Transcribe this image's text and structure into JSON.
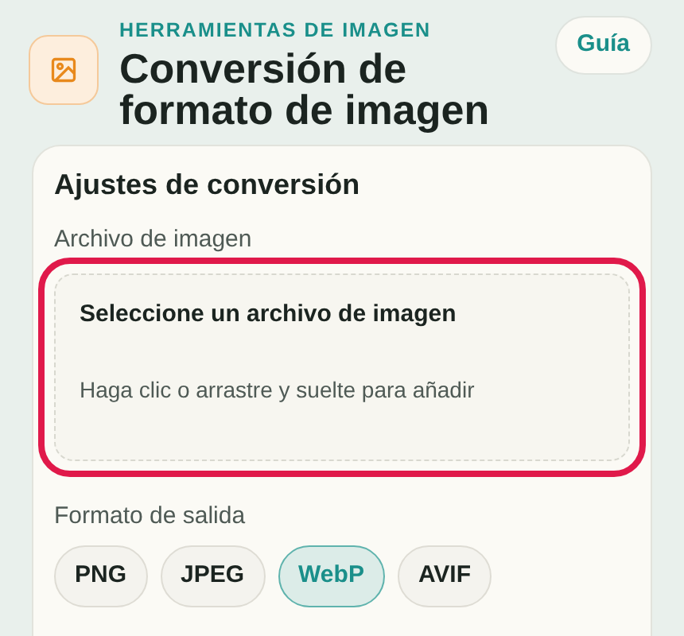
{
  "header": {
    "eyebrow": "HERRAMIENTAS DE IMAGEN",
    "title": "Conversión de formato de imagen",
    "guide_button": "Guía"
  },
  "card": {
    "title": "Ajustes de conversión",
    "file_field": {
      "label": "Archivo de imagen",
      "highlighted": true,
      "dropzone_title": "Seleccione un archivo de imagen",
      "dropzone_hint": "Haga clic o arrastre y suelte para añadir"
    },
    "format_field": {
      "label": "Formato de salida",
      "options": [
        {
          "label": "PNG",
          "selected": false
        },
        {
          "label": "JPEG",
          "selected": false
        },
        {
          "label": "WebP",
          "selected": true
        },
        {
          "label": "AVIF",
          "selected": false
        }
      ]
    }
  }
}
